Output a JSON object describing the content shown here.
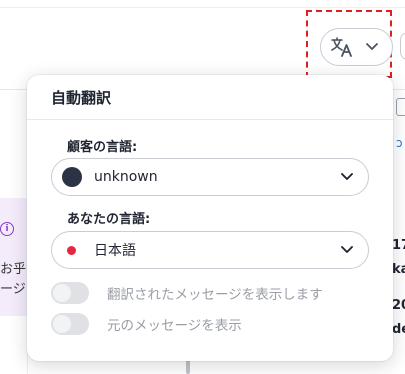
{
  "translate_trigger": {
    "icon": "translate-icon",
    "chevron": "chevron-down-icon"
  },
  "panel": {
    "title": "自動翻訳",
    "customer_language": {
      "label": "顧客の言語:",
      "value": "unknown"
    },
    "your_language": {
      "label": "あなたの言語:",
      "value": "日本語"
    },
    "toggles": [
      {
        "label": "翻訳されたメッセージを表示します",
        "on": false
      },
      {
        "label": "元のメッセージを表示",
        "on": false
      }
    ]
  },
  "background": {
    "side_text": [
      "お乎",
      "ージ"
    ],
    "right_text": [
      "17",
      "ka",
      "20",
      "de"
    ]
  },
  "colors": {
    "highlight": "#e0201c",
    "dark_dot": "#2c3347",
    "red_dot": "#e8263d",
    "purple_card": "#f4ecfb",
    "accent_purple": "#8a3cc7"
  }
}
